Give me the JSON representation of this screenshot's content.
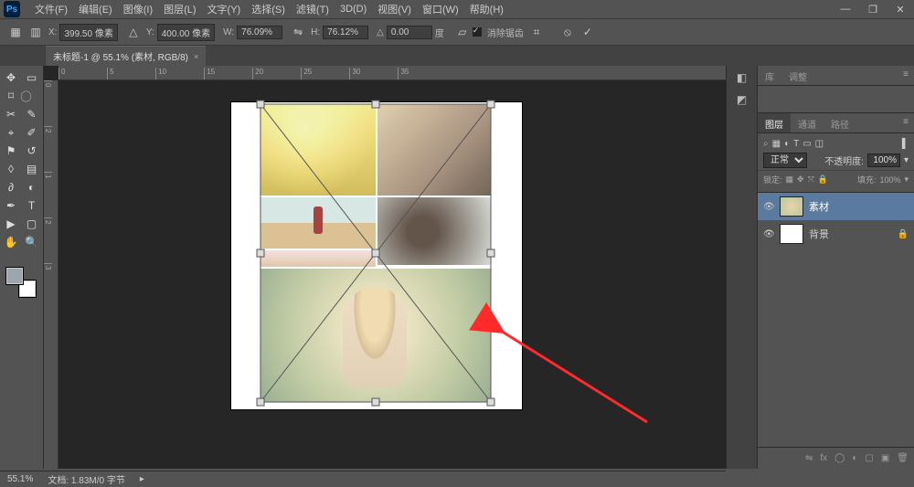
{
  "menubar": {
    "logo": "Ps",
    "items": [
      "文件(F)",
      "编辑(E)",
      "图像(I)",
      "图层(L)",
      "文字(Y)",
      "选择(S)",
      "滤镜(T)",
      "3D(D)",
      "视图(V)",
      "窗口(W)",
      "帮助(H)"
    ]
  },
  "window_controls": {
    "min": "—",
    "max": "❐",
    "close": "✕"
  },
  "options": {
    "xlabel": "X:",
    "x": "399.50 像素",
    "ylabel": "Y:",
    "y": "400.00 像素",
    "wlabel": "W:",
    "w": "76.09%",
    "hlabel": "H:",
    "h": "76.12%",
    "anglelabel": "△",
    "angle": "0.00",
    "angle_unit": "度",
    "antialias": "消除锯齿"
  },
  "tab": {
    "title": "未标题-1 @ 55.1% (素材, RGB/8)",
    "close": "×"
  },
  "ruler_h": [
    "0",
    "5",
    "10",
    "15",
    "20",
    "25",
    "30",
    "35"
  ],
  "ruler_v": [
    "0",
    "",
    "2",
    "",
    "1",
    "",
    "2",
    "",
    "3"
  ],
  "panels": {
    "set1": [
      "库",
      "调整"
    ],
    "set2": [
      "图层",
      "通道",
      "路径"
    ],
    "blend_mode": "正常",
    "opacity_label": "不透明度:",
    "opacity": "100%",
    "lock_label": "锁定:",
    "fill_label": "填充:",
    "fill": "100%"
  },
  "layers": [
    {
      "name": "素材",
      "locked": false
    },
    {
      "name": "背景",
      "locked": true
    }
  ],
  "status": {
    "zoom": "55.1%",
    "doc": "文档: 1.83M/0 字节"
  }
}
